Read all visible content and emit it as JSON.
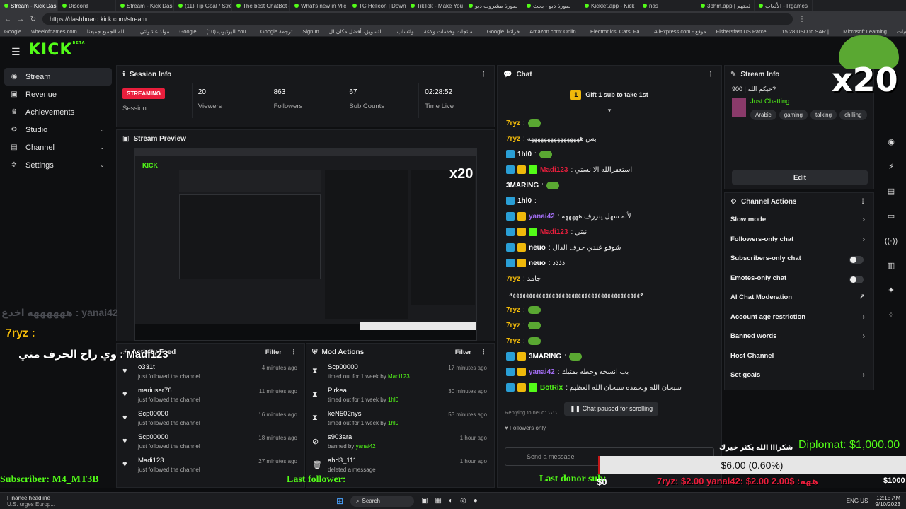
{
  "browser": {
    "tabs": [
      "Stream - Kick Dash",
      "Discord",
      "Stream - Kick Dash",
      "(11) Tip Goal / Stre",
      "The best ChatBot o",
      "What's new in Mic",
      "TC Helicon | Down",
      "TikTok - Make You",
      "صورة مشروب ديو",
      "صورة ديو - بحث",
      "Kicklet.app - Kick",
      "nas",
      "3bhm.app | لحتهم",
      "الألعاب - Rgames"
    ],
    "url": "https://dashboard.kick.com/stream",
    "bookmarks": [
      "Google",
      "wheelofnames.com",
      "الله للجميع جميعنا...",
      "مولد عشوائي",
      "Google",
      "(10) اليوتيوب You...",
      "Google ترجمة",
      "Sign In",
      "التسويق، أفضل مكان لل...",
      "واتساب",
      "منتجات وخدمات ولاعة...",
      "Google خرائط",
      "Amazon.com: Onlin...",
      "Electronics, Cars, Fa...",
      "AliExpress.com - موقع",
      "Fishersfast US Parcel...",
      "15.28 USD to SAR |...",
      "Microsoft Learning",
      "الخلفيات"
    ]
  },
  "app": {
    "logo": "KICK",
    "logo_sup": "BETA",
    "sidebar": [
      {
        "label": "Stream",
        "icon": "broadcast-icon",
        "active": true
      },
      {
        "label": "Revenue",
        "icon": "wallet-icon"
      },
      {
        "label": "Achievements",
        "icon": "trophy-icon"
      },
      {
        "label": "Studio",
        "icon": "sliders-icon",
        "chev": true
      },
      {
        "label": "Channel",
        "icon": "channel-icon",
        "chev": true
      },
      {
        "label": "Settings",
        "icon": "gear-icon",
        "chev": true
      }
    ]
  },
  "session": {
    "title": "Session Info",
    "live_badge": "STREAMING",
    "session_label": "Session",
    "stats": [
      {
        "value": "20",
        "label": "Viewers"
      },
      {
        "value": "863",
        "label": "Followers"
      },
      {
        "value": "67",
        "label": "Sub Counts"
      },
      {
        "value": "02:28:52",
        "label": "Time Live"
      }
    ]
  },
  "preview": {
    "title": "Stream Preview"
  },
  "activity": {
    "title": "Activity Feed",
    "filter": "Filter",
    "items": [
      {
        "name": "o331t",
        "action": "just followed the channel",
        "time": "4 minutes ago"
      },
      {
        "name": "mariuser76",
        "action": "just followed the channel",
        "time": "11 minutes ago"
      },
      {
        "name": "Scp00000",
        "action": "just followed the channel",
        "time": "16 minutes ago"
      },
      {
        "name": "Scp00000",
        "action": "just followed the channel",
        "time": "18 minutes ago"
      },
      {
        "name": "Madi123",
        "action": "just followed the channel",
        "time": "27 minutes ago"
      }
    ]
  },
  "mod": {
    "title": "Mod Actions",
    "filter": "Filter",
    "items": [
      {
        "name": "Scp00000",
        "action": "timed out for 1 week by",
        "by": "Madi123",
        "time": "17 minutes ago",
        "icon": "hourglass-icon"
      },
      {
        "name": "Pirkea",
        "action": "timed out for 1 week by",
        "by": "1hl0",
        "time": "30 minutes ago",
        "icon": "hourglass-icon"
      },
      {
        "name": "keN502nys",
        "action": "timed out for 1 week by",
        "by": "1hl0",
        "time": "53 minutes ago",
        "icon": "hourglass-icon"
      },
      {
        "name": "s903ara",
        "action": "banned by",
        "by": "yanai42",
        "time": "1 hour ago",
        "icon": "ban-icon"
      },
      {
        "name": "ahd3_111",
        "action": "deleted a message",
        "by": "",
        "time": "1 hour ago",
        "icon": "trash-icon"
      }
    ]
  },
  "chat": {
    "title": "Chat",
    "goal": "Gift 1 sub to take 1st",
    "goal_count": "1",
    "messages": [
      {
        "user": "7ryz",
        "color": "#f0b90b",
        "text": ":",
        "badges": [],
        "emote": true
      },
      {
        "user": "7ryz",
        "color": "#f0b90b",
        "text": ": بس ههههههههههههههههه",
        "badges": []
      },
      {
        "user": "1hl0",
        "color": "#ffffff",
        "text": ":",
        "badges": [
          "blue"
        ],
        "emote": true
      },
      {
        "user": "Madi123",
        "color": "#e91e3c",
        "text": ": استغفرالله الا نستي",
        "badges": [
          "blue",
          "gold",
          "green"
        ]
      },
      {
        "user": "3MARING",
        "color": "#ffffff",
        "text": ":",
        "badges": [],
        "emote": true
      },
      {
        "user": "1hl0",
        "color": "#ffffff",
        "text": ":",
        "badges": [
          "blue"
        ]
      },
      {
        "user": "yanai42",
        "color": "#a06cf0",
        "text": ": لأنه سهل ينزرف هههههه",
        "badges": [
          "blue",
          "gold"
        ]
      },
      {
        "user": "Madi123",
        "color": "#e91e3c",
        "text": ": نيتي",
        "badges": [
          "blue",
          "gold",
          "green"
        ]
      },
      {
        "user": "neuo",
        "color": "#ffffff",
        "text": ": شوفو عندي حرف الذال",
        "badges": [
          "blue",
          "gold"
        ]
      },
      {
        "user": "neuo",
        "color": "#ffffff",
        "text": ": ذذذذ",
        "badges": [
          "blue",
          "gold"
        ]
      },
      {
        "user": "7ryz",
        "color": "#f0b90b",
        "text": ": جامد",
        "badges": []
      },
      {
        "user": "",
        "color": "#ffffff",
        "text": "ههههههههههههههههههههههههههههههههههههههههه",
        "badges": []
      },
      {
        "user": "7ryz",
        "color": "#f0b90b",
        "text": ":",
        "badges": [],
        "emote": true
      },
      {
        "user": "7ryz",
        "color": "#f0b90b",
        "text": ":",
        "badges": [],
        "emote": true
      },
      {
        "user": "7ryz",
        "color": "#f0b90b",
        "text": ":",
        "badges": [],
        "emote": true
      },
      {
        "user": "3MARING",
        "color": "#ffffff",
        "text": ":",
        "badges": [
          "blue",
          "gold"
        ],
        "emote": true
      },
      {
        "user": "yanai42",
        "color": "#a06cf0",
        "text": ": يب انسخه وحطه بمتيك",
        "badges": [
          "blue",
          "gold"
        ]
      },
      {
        "user": "BotRix",
        "color": "#53fc18",
        "text": ": سبحان الله وبحمده سبحان الله العظيم",
        "badges": [
          "blue",
          "gold",
          "green"
        ]
      }
    ],
    "replying": "Replying to neuo: ذذذذ",
    "paused": "Chat paused for scrolling",
    "followers_only": "Followers only",
    "send_placeholder": "Send a message"
  },
  "stream_info": {
    "title": "Stream Info",
    "stream_title": "حيكم الله | 900?",
    "category": "Just Chatting",
    "tags": [
      "Arabic",
      "gaming",
      "talking",
      "chilling"
    ],
    "edit": "Edit"
  },
  "channel_actions": {
    "title": "Channel Actions",
    "items": [
      {
        "label": "Slow mode",
        "type": "chev"
      },
      {
        "label": "Followers-only chat",
        "type": "chev"
      },
      {
        "label": "Subscribers-only chat",
        "type": "toggle"
      },
      {
        "label": "Emotes-only chat",
        "type": "toggle"
      },
      {
        "label": "AI Chat Moderation",
        "type": "ext"
      },
      {
        "label": "Account age restriction",
        "type": "chev"
      },
      {
        "label": "Banned words",
        "type": "chev"
      },
      {
        "label": "Host Channel",
        "type": "none"
      },
      {
        "label": "Set goals",
        "type": "chev"
      }
    ]
  },
  "overlay": {
    "x20": "x20",
    "ghost_text": "ههههههه اخدع : yanai42",
    "chat1": "7ryz :",
    "chat2": "وي راح الحرف مني : Madi123",
    "diplomat": "Diplomat: $1,000.00",
    "goal_bar": "$6.00 (0.60%)",
    "goal_progress": 0.006,
    "goal_caption": "شكرااا الله يكثر خيرك",
    "goal_start": "$0",
    "goal_end": "$1000",
    "subscriber": "Subscriber: M4_MT3B",
    "last_follower": "Last follower:",
    "last_donor": "Last donor sub:",
    "ticker": "7ryz: $2.00 yanai42: $2.00 2.00$ :ههه"
  },
  "taskbar": {
    "news_title": "Finance headline",
    "news_sub": "U.S. urges Europ...",
    "search": "Search",
    "lang": "ENG US",
    "time": "12:15 AM",
    "date": "9/10/2023"
  }
}
